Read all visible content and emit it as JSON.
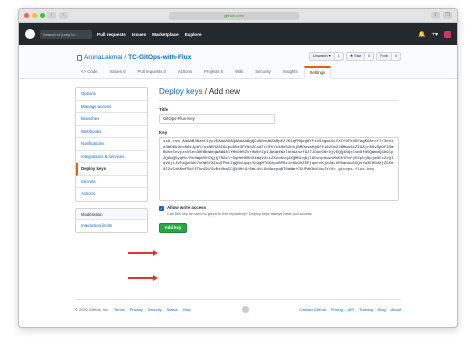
{
  "browser": {
    "url": "github.com",
    "dot_colors": [
      "#ff5f57",
      "#ffbd2e",
      "#28c940"
    ]
  },
  "github": {
    "search_placeholder": "Search or jump to...",
    "nav": [
      "Pull requests",
      "Issues",
      "Marketplace",
      "Explore"
    ],
    "bell": "🔔",
    "plus": "+▾"
  },
  "repo": {
    "owner": "ArunaLakmal",
    "separator": "/",
    "name": "TC-GitOps-with-Flux",
    "actions": [
      {
        "label": "Unwatch ▾",
        "count": "1"
      },
      {
        "label": "★ Star",
        "count": "0"
      },
      {
        "label": "Fork",
        "count": "0"
      }
    ],
    "tabs": [
      "<> Code",
      "Issues 0",
      "Pull requests 0",
      "Actions",
      "Projects 0",
      "Wiki",
      "Security",
      "Insights",
      "Settings"
    ],
    "active_tab": 8
  },
  "sidebar": {
    "items": [
      "Options",
      "Manage access",
      "Branches",
      "Webhooks",
      "Notifications",
      "Integrations & services",
      "Deploy keys",
      "Secrets",
      "Actions"
    ],
    "selected": 6,
    "moderation_header": "Moderation",
    "moderation_items": [
      "Interaction limits"
    ]
  },
  "form": {
    "breadcrumb_link": "Deploy keys",
    "breadcrumb_sep": " / ",
    "breadcrumb_current": "Add new",
    "title_label": "Title",
    "title_value": "GitOps-Flux-Key",
    "key_label": "Key",
    "key_value": "ssh-rsa AAAAB3NzaC1yc2EAAAADAQABAAABgQCuNSsUmZaRpEZJK1qPMQeg8YFsVS4gmiOLCXLf6FkUDFagKOArcf7/3ehiz3WD6k9ccB6kJp8Y/ssNEH28I6Lpo8Se3PYN4ZCsATrUFkYu4HeS2bhjBMOwsaHgGffi62Cm2JBMws6LZIGAjrBHvSpGf33mB9heCnvyzsV5ecGHHBbWeqWAW68lYMnDHRZvrHWhfZpIJWuWtWzlkhWzdzf9JTJDAcGNrDjyEQQ4NQxlsm8f85QWmdQ3bGlpZQGwQ5yqMv/Rn3WpNVH7QjQ7RAxl+DqHeHH8nX4NqV2cLZXzoKtq4XQMGLqBjl6OvxpVwzsMsRkYRxFyDZpbjNpjaHCx2xQIqVdjLJVFaQzHdb7oOWSfXZuqTPmtZgQNvUpqxYb3gMT6XXpnBPRz1c6kGhZ5Pjqm+cKjmJaLhRkmnkwCEQsYw3EHGdXjZ5Xe8I2zCxKKmFSbYfTbnZN/SvRsVbaCCQVdHr8/6mL4tLGdUwzpqBT0aWm+C5UPdK6wlUwJYr0= gitops-flux-key",
    "checkbox_label": "Allow write access",
    "checkbox_note_pre": "Can this key be used to ",
    "checkbox_note_code": "push",
    "checkbox_note_post": " to this repository? Deploy keys always have pull access.",
    "button": "Add key"
  },
  "footer": {
    "copyright": "© 2020 GitHub, Inc.",
    "left_links": [
      "Terms",
      "Privacy",
      "Security",
      "Status",
      "Help"
    ],
    "right_links": [
      "Contact GitHub",
      "Pricing",
      "API",
      "Training",
      "Blog",
      "About"
    ]
  },
  "colors": {
    "arrow": "#e3342f",
    "accent_tab": "#e36209",
    "button_green": "#28a745",
    "link": "#0366d6"
  }
}
